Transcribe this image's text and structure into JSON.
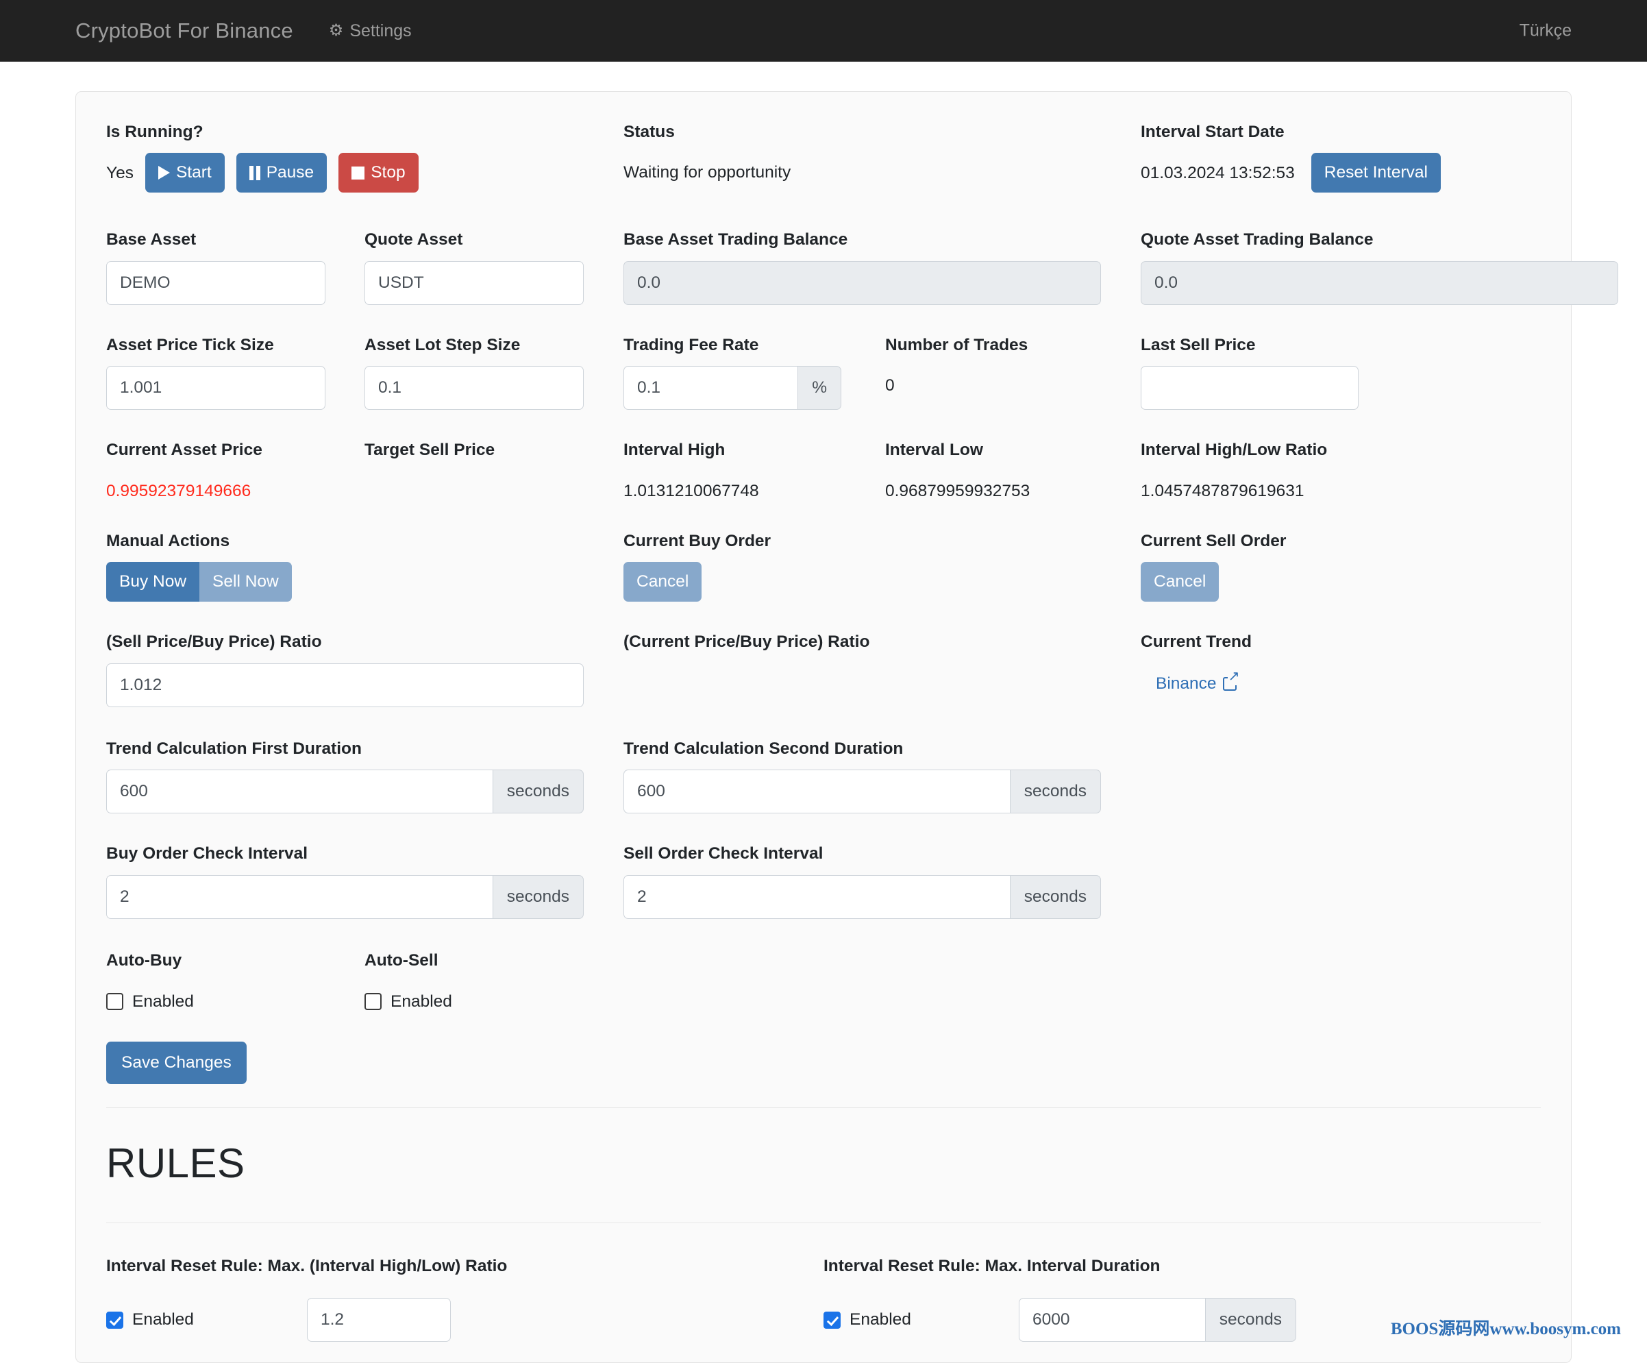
{
  "navbar": {
    "brand": "CryptoBot For Binance",
    "settings_label": "Settings",
    "gear_icon": "gear-icon",
    "language": "Türkçe"
  },
  "status_row": {
    "is_running_label": "Is Running?",
    "is_running_value": "Yes",
    "start_button": "Start",
    "pause_button": "Pause",
    "stop_button": "Stop",
    "status_label": "Status",
    "status_value": "Waiting for opportunity",
    "interval_start_date_label": "Interval Start Date",
    "interval_start_date_value": "01.03.2024 13:52:53",
    "reset_interval_button": "Reset Interval"
  },
  "assets": {
    "base_asset_label": "Base Asset",
    "base_asset_value": "DEMO",
    "quote_asset_label": "Quote Asset",
    "quote_asset_value": "USDT",
    "base_asset_trading_balance_label": "Base Asset Trading Balance",
    "base_asset_trading_balance_value": "0.0",
    "quote_asset_trading_balance_label": "Quote Asset Trading Balance",
    "quote_asset_trading_balance_value": "0.0"
  },
  "sizes": {
    "asset_price_tick_size_label": "Asset Price Tick Size",
    "asset_price_tick_size_value": "1.001",
    "asset_lot_step_size_label": "Asset Lot Step Size",
    "asset_lot_step_size_value": "0.1",
    "trading_fee_rate_label": "Trading Fee Rate",
    "trading_fee_rate_value": "0.1",
    "trading_fee_rate_unit": "%",
    "number_of_trades_label": "Number of Trades",
    "number_of_trades_value": "0",
    "last_sell_price_label": "Last Sell Price",
    "last_sell_price_value": ""
  },
  "prices": {
    "current_asset_price_label": "Current Asset Price",
    "current_asset_price_value": "0.99592379149666",
    "target_sell_price_label": "Target Sell Price",
    "target_sell_price_value": "",
    "interval_high_label": "Interval High",
    "interval_high_value": "1.0131210067748",
    "interval_low_label": "Interval Low",
    "interval_low_value": "0.96879959932753",
    "interval_high_low_ratio_label": "Interval High/Low Ratio",
    "interval_high_low_ratio_value": "1.0457487879619631"
  },
  "orders": {
    "manual_actions_label": "Manual Actions",
    "buy_now_button": "Buy Now",
    "sell_now_button": "Sell Now",
    "current_buy_order_label": "Current Buy Order",
    "buy_cancel_button": "Cancel",
    "current_sell_order_label": "Current Sell Order",
    "sell_cancel_button": "Cancel",
    "sell_buy_ratio_label": "(Sell Price/Buy Price) Ratio",
    "sell_buy_ratio_value": "1.012",
    "current_buy_ratio_label": "(Current Price/Buy Price) Ratio",
    "current_trend_label": "Current Trend",
    "current_trend_link": "Binance",
    "external_link_icon": "external-link-icon"
  },
  "durations": {
    "trend_first_label": "Trend Calculation First Duration",
    "trend_first_value": "600",
    "trend_first_unit": "seconds",
    "trend_second_label": "Trend Calculation Second Duration",
    "trend_second_value": "600",
    "trend_second_unit": "seconds",
    "buy_check_label": "Buy Order Check Interval",
    "buy_check_value": "2",
    "buy_check_unit": "seconds",
    "sell_check_label": "Sell Order Check Interval",
    "sell_check_value": "2",
    "sell_check_unit": "seconds"
  },
  "auto": {
    "auto_buy_label": "Auto-Buy",
    "auto_buy_enabled_label": "Enabled",
    "auto_buy_checked": false,
    "auto_sell_label": "Auto-Sell",
    "auto_sell_enabled_label": "Enabled",
    "auto_sell_checked": false,
    "save_changes_button": "Save Changes"
  },
  "rules": {
    "heading": "RULES",
    "ratio_rule_label": "Interval Reset Rule: Max. (Interval High/Low) Ratio",
    "ratio_rule_enabled_label": "Enabled",
    "ratio_rule_value": "1.2",
    "duration_rule_label": "Interval Reset Rule: Max. Interval Duration",
    "duration_rule_enabled_label": "Enabled",
    "duration_rule_value": "6000",
    "duration_rule_unit": "seconds"
  },
  "watermark": "BOOS源码网www.boosym.com",
  "colors": {
    "navbar_bg": "#222222",
    "primary": "#4279b0",
    "danger": "#cb4a45",
    "soft": "#87a8cb",
    "price_red": "#ff2b1d",
    "link": "#2f6fb5"
  }
}
